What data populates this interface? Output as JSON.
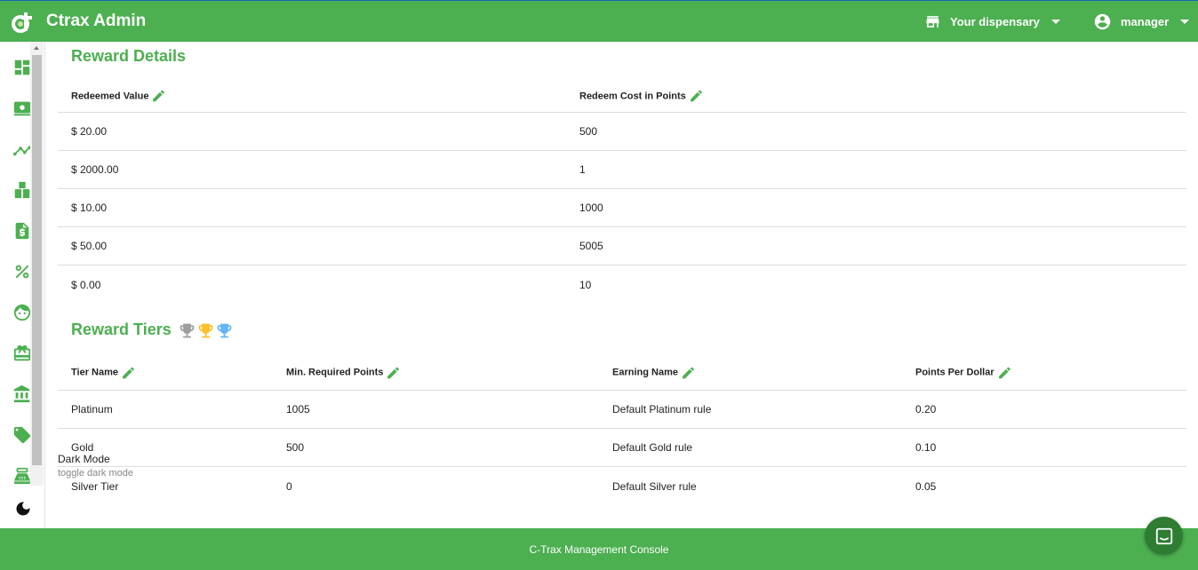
{
  "header": {
    "app_title": "Ctrax Admin",
    "store_label": "Your dispensary",
    "user_label": "manager"
  },
  "sidebar": {
    "items": [
      {
        "icon": "dashboard-icon"
      },
      {
        "icon": "point-of-sale-icon"
      },
      {
        "icon": "analytics-icon"
      },
      {
        "icon": "inventory-icon"
      },
      {
        "icon": "invoice-icon"
      },
      {
        "icon": "discount-icon"
      },
      {
        "icon": "customers-icon"
      },
      {
        "icon": "gift-icon"
      },
      {
        "icon": "bank-icon"
      },
      {
        "icon": "tags-icon"
      },
      {
        "icon": "register-icon"
      }
    ],
    "dark_mode_label": "Dark Mode",
    "dark_mode_sub": "toggle dark mode"
  },
  "reward_details": {
    "title": "Reward Details",
    "columns": [
      "Redeemed Value",
      "Redeem Cost in Points"
    ],
    "rows": [
      [
        "$ 20.00",
        "500"
      ],
      [
        "$ 2000.00",
        "1"
      ],
      [
        "$ 10.00",
        "1000"
      ],
      [
        "$ 50.00",
        "5005"
      ],
      [
        "$ 0.00",
        "10"
      ]
    ]
  },
  "reward_tiers": {
    "title": "Reward Tiers",
    "trophy_colors": [
      "#9e9e9e",
      "#fbc02d",
      "#64b5f6"
    ],
    "columns": [
      "Tier Name",
      "Min. Required Points",
      "Earning Name",
      "Points Per Dollar"
    ],
    "rows": [
      [
        "Platinum",
        "1005",
        "Default Platinum rule",
        "0.20"
      ],
      [
        "Gold",
        "500",
        "Default Gold rule",
        "0.10"
      ],
      [
        "Silver Tier",
        "0",
        "Default Silver rule",
        "0.05"
      ]
    ]
  },
  "footer": {
    "text": "C-Trax Management Console"
  },
  "colors": {
    "brand": "#4caf50",
    "brand_dark": "#2e7d32"
  }
}
